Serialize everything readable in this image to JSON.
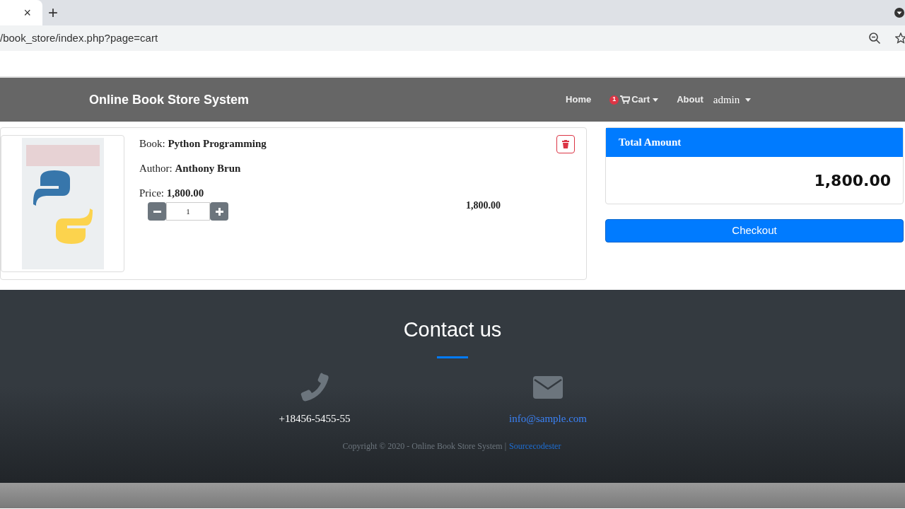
{
  "browser": {
    "tab_close": "×",
    "new_tab": "+",
    "url": "/book_store/index.php?page=cart"
  },
  "navbar": {
    "brand": "Online Book Store System",
    "links": [
      {
        "kind": "link",
        "label": "Home"
      },
      {
        "kind": "cart",
        "label": "Cart",
        "badge": "1"
      },
      {
        "kind": "link",
        "label": "About"
      },
      {
        "kind": "user",
        "label": "admin"
      }
    ]
  },
  "cart_items": [
    {
      "book": "Book: **Python Programming**",
      "author": "Author: **Anthony Brun**",
      "price": "Price: **1,800.00**",
      "quantity": "1",
      "subtotal": "1,800.00"
    }
  ],
  "total": {
    "title": "Total Amount",
    "amount": "1,800.00"
  },
  "checkout": "Checkout",
  "footer": {
    "title": "Contact us",
    "phone": "+18456-5455-55",
    "email": "info@sample.com",
    "copyright": "Copyright © 2020 - Online Book Store System |",
    "credit": "Sourcecodester"
  }
}
